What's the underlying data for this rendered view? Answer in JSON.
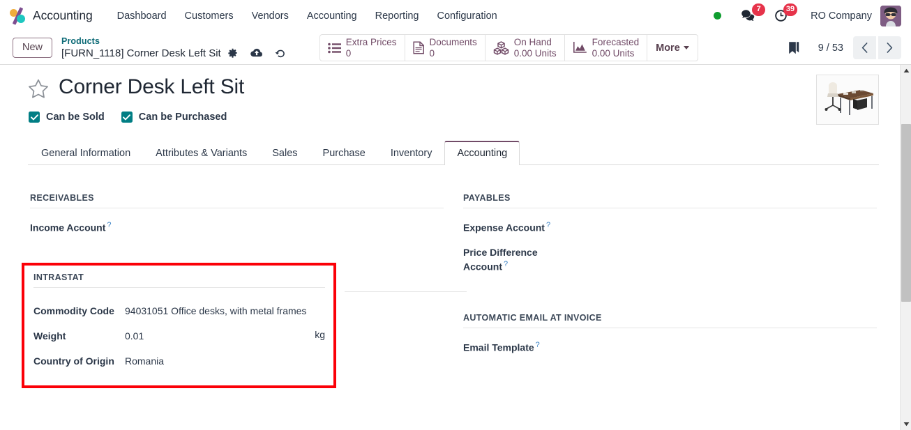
{
  "navbar": {
    "brand": "Accounting",
    "logo_icon": "odoo-logo-icon",
    "menu_items": [
      {
        "label": "Dashboard"
      },
      {
        "label": "Customers"
      },
      {
        "label": "Vendors"
      },
      {
        "label": "Accounting"
      },
      {
        "label": "Reporting"
      },
      {
        "label": "Configuration"
      }
    ],
    "status_indicator_color": "#0f9d2f",
    "messages": {
      "icon": "chat-bubble-icon",
      "badge": "7"
    },
    "activities": {
      "icon": "clock-icon",
      "badge": "39"
    },
    "company": "RO Company",
    "avatar_icon": "user-avatar-icon"
  },
  "control_panel": {
    "new_button": "New",
    "breadcrumb": {
      "parent": "Products",
      "current": "[FURN_1118] Corner Desk Left Sit"
    },
    "record_actions": [
      {
        "icon": "gear-icon",
        "name": "settings"
      },
      {
        "icon": "cloud-upload-icon",
        "name": "save"
      },
      {
        "icon": "undo-icon",
        "name": "discard"
      }
    ],
    "stat_buttons": [
      {
        "icon": "list-icon",
        "label": "Extra Prices",
        "value": "0"
      },
      {
        "icon": "document-icon",
        "label": "Documents",
        "value": "0"
      },
      {
        "icon": "cubes-icon",
        "label": "On Hand",
        "value": "0.00 Units"
      },
      {
        "icon": "area-chart-icon",
        "label": "Forecasted",
        "value": "0.00 Units"
      }
    ],
    "more_button": "More",
    "bookmark_icon": "bookmark-icon",
    "pager": {
      "count": "9 / 53",
      "prev_icon": "chevron-left-icon",
      "next_icon": "chevron-right-icon"
    }
  },
  "record": {
    "favorite_icon": "star-outline-icon",
    "title": "Corner Desk Left Sit",
    "checkboxes": [
      {
        "label": "Can be Sold",
        "checked": true
      },
      {
        "label": "Can be Purchased",
        "checked": true
      }
    ],
    "image_alt": "corner-desk-product-photo"
  },
  "tabs": [
    {
      "label": "General Information",
      "active": false
    },
    {
      "label": "Attributes & Variants",
      "active": false
    },
    {
      "label": "Sales",
      "active": false
    },
    {
      "label": "Purchase",
      "active": false
    },
    {
      "label": "Inventory",
      "active": false
    },
    {
      "label": "Accounting",
      "active": true
    }
  ],
  "form": {
    "receivables": {
      "title": "RECEIVABLES",
      "fields": [
        {
          "label": "Income Account",
          "help": "?",
          "value": ""
        }
      ]
    },
    "payables": {
      "title": "PAYABLES",
      "fields": [
        {
          "label": "Expense Account",
          "help": "?",
          "value": ""
        },
        {
          "label": "Price Difference Account",
          "help": "?",
          "value": ""
        }
      ]
    },
    "intrastat": {
      "title": "INTRASTAT",
      "highlighted": true,
      "highlight_color": "#fb0007",
      "fields": [
        {
          "label": "Commodity Code",
          "value": "94031051 Office desks, with metal frames",
          "suffix": ""
        },
        {
          "label": "Weight",
          "value": "0.01",
          "suffix": "kg"
        },
        {
          "label": "Country of Origin",
          "value": "Romania",
          "suffix": ""
        }
      ]
    },
    "automatic_email": {
      "title": "AUTOMATIC EMAIL AT INVOICE",
      "fields": [
        {
          "label": "Email Template",
          "help": "?",
          "value": ""
        }
      ]
    }
  },
  "scrollbar": {
    "up_icon": "triangle-up-icon",
    "down_icon": "triangle-down-icon"
  }
}
